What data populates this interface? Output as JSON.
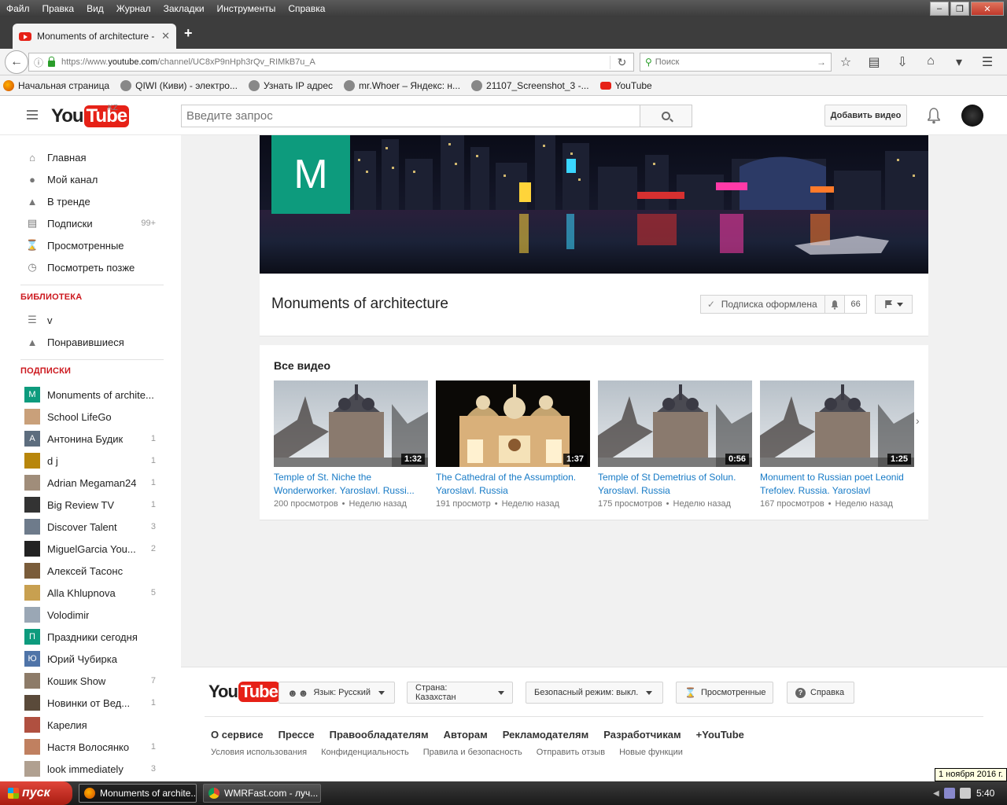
{
  "browser": {
    "menu": [
      "Файл",
      "Правка",
      "Вид",
      "Журнал",
      "Закладки",
      "Инструменты",
      "Справка"
    ],
    "tab_title": "Monuments of architecture - Y...",
    "url_prefix": "https://www.",
    "url_domain": "youtube.com",
    "url_path": "/channel/UC8xP9nHph3rQv_RIMkB7u_A",
    "search_placeholder": "Поиск",
    "bookmarks": [
      {
        "label": "Начальная страница",
        "icon": "firefox-icon"
      },
      {
        "label": "QIWI (Киви) - электро...",
        "icon": "globe-icon"
      },
      {
        "label": "Узнать IP адрес",
        "icon": "globe-icon"
      },
      {
        "label": "mr.Whoer – Яндекс: н...",
        "icon": "globe-icon"
      },
      {
        "label": "21107_Screenshot_3 -...",
        "icon": "globe-icon"
      },
      {
        "label": "YouTube",
        "icon": "youtube-icon"
      }
    ]
  },
  "header": {
    "logo_you": "You",
    "logo_tube": "Tube",
    "region": "KZ",
    "search_placeholder": "Введите запрос",
    "upload_label": "Добавить видео"
  },
  "sidebar": {
    "main": [
      {
        "label": "Главная",
        "icon": "home-icon"
      },
      {
        "label": "Мой канал",
        "icon": "account-icon"
      },
      {
        "label": "В тренде",
        "icon": "flame-icon"
      },
      {
        "label": "Подписки",
        "icon": "subscriptions-icon",
        "count": "99+"
      },
      {
        "label": "Просмотренные",
        "icon": "hourglass-icon"
      },
      {
        "label": "Посмотреть позже",
        "icon": "clock-icon"
      }
    ],
    "library_title": "БИБЛИОТЕКА",
    "library": [
      {
        "label": "v",
        "icon": "playlist-icon"
      },
      {
        "label": "Понравившиеся",
        "icon": "thumbs-up-icon"
      }
    ],
    "subscriptions_title": "ПОДПИСКИ",
    "subscriptions": [
      {
        "label": "Monuments of archite...",
        "letter": "M",
        "color": "#0d9b7d",
        "count": ""
      },
      {
        "label": "School LifeGo",
        "letter": "",
        "color": "#c9a07a",
        "count": ""
      },
      {
        "label": "Антонина Будик",
        "letter": "А",
        "color": "#5d6d7e",
        "count": "1"
      },
      {
        "label": "d j",
        "letter": "",
        "color": "#b8860b",
        "count": "1"
      },
      {
        "label": "Adrian Megaman24",
        "letter": "",
        "color": "#a08d7a",
        "count": "1"
      },
      {
        "label": "Big Review TV",
        "letter": "",
        "color": "#333333",
        "count": "1"
      },
      {
        "label": "Discover Talent",
        "letter": "",
        "color": "#6e7b8b",
        "count": "3"
      },
      {
        "label": "MiguelGarcia You...",
        "letter": "",
        "color": "#222222",
        "count": "2"
      },
      {
        "label": "Алексей Тасонс",
        "letter": "",
        "color": "#7a5c3a",
        "count": ""
      },
      {
        "label": "Alla Khlupnova",
        "letter": "",
        "color": "#c8a050",
        "count": "5"
      },
      {
        "label": "Volodimir",
        "letter": "",
        "color": "#9aa7b5",
        "count": ""
      },
      {
        "label": "Праздники сегодня",
        "letter": "П",
        "color": "#0d9b7d",
        "count": ""
      },
      {
        "label": "Юрий Чубирка",
        "letter": "Ю",
        "color": "#4f74a8",
        "count": ""
      },
      {
        "label": "Кошик Show",
        "letter": "",
        "color": "#8d7b68",
        "count": "7"
      },
      {
        "label": "Новинки от Вед...",
        "letter": "",
        "color": "#5a4a3a",
        "count": "1"
      },
      {
        "label": "Карелия",
        "letter": "",
        "color": "#b05040",
        "count": ""
      },
      {
        "label": "Настя Волосянко",
        "letter": "",
        "color": "#c08060",
        "count": "1"
      },
      {
        "label": "look immediately",
        "letter": "",
        "color": "#b0a090",
        "count": "3"
      }
    ]
  },
  "channel": {
    "avatar_letter": "M",
    "title": "Monuments of architecture",
    "subscribe_label": "Подписка оформлена",
    "subscriber_count": "66",
    "videos_heading": "Все видео",
    "videos": [
      {
        "title": "Temple of St. Niche the Wonderworker. Yaroslavl. Russi...",
        "duration": "1:32",
        "views": "200 просмотров",
        "age": "Неделю назад",
        "theme": "sky"
      },
      {
        "title": "The Cathedral of the Assumption. Yaroslavl. Russia",
        "duration": "1:37",
        "views": "191 просмотр",
        "age": "Неделю назад",
        "theme": "night"
      },
      {
        "title": "Temple of St Demetrius of Solun. Yaroslavl. Russia",
        "duration": "0:56",
        "views": "175 просмотров",
        "age": "Неделю назад",
        "theme": "sky"
      },
      {
        "title": "Monument to Russian poet Leonid Trefolev. Russia. Yaroslavl",
        "duration": "1:25",
        "views": "167 просмотров",
        "age": "Неделю назад",
        "theme": "sky"
      }
    ],
    "separator": "•",
    "accent_color": "#0d9b7d"
  },
  "footer": {
    "language": "Язык: Русский",
    "country": "Страна: Казахстан",
    "safety": "Безопасный режим: выкл.",
    "history": "Просмотренные",
    "help": "Справка",
    "links_primary": [
      "О сервисе",
      "Прессе",
      "Правообладателям",
      "Авторам",
      "Рекламодателям",
      "Разработчикам",
      "+YouTube"
    ],
    "links_secondary": [
      "Условия использования",
      "Конфиденциальность",
      "Правила и безопасность",
      "Отправить отзыв",
      "Новые функции"
    ]
  },
  "taskbar": {
    "start_label": "пуск",
    "tasks": [
      {
        "label": "Monuments of archite...",
        "active": true
      },
      {
        "label": "WMRFast.com - луч...",
        "active": false
      }
    ],
    "clock": "5:40",
    "date_tooltip": "1 ноября 2016 г."
  }
}
